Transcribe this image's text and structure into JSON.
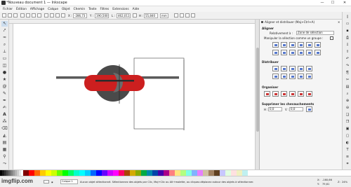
{
  "window": {
    "title": "*Nouveau document 1 — Inkscape",
    "min": "—",
    "max": "☐",
    "close": "✕"
  },
  "menu": [
    "Fichier",
    "Édition",
    "Affichage",
    "Calque",
    "Objet",
    "Chemin",
    "Texte",
    "Filtres",
    "Extensions",
    "Aide"
  ],
  "toolctrl": {
    "x_label": "X :",
    "x": "-286,73",
    "y_label": "Y :",
    "y": "190,500",
    "w_label": "L :",
    "w": "462,011",
    "h_label": "H :",
    "h": "55,840",
    "unit": "mm"
  },
  "panel": {
    "title": "Aligner et distribuer (Maj+Ctrl+A)",
    "align_header": "Aligner",
    "relative_label": "Relativement à :",
    "relative_value": "Zone de sélection",
    "treat_label": "Manipuler la sélection comme un groupe :",
    "distribute_header": "Distribuer",
    "arrange_header": "Organiser",
    "overlap_header": "Supprimer les chevauchements",
    "h_label": "H :",
    "h_value": "0,0",
    "v_label": "V :",
    "v_value": "0,0"
  },
  "status": {
    "layer": "Calque 1",
    "message": "Aucun objet sélectionné. Sélectionnez des objets par Clic, Maj+Clic ou Alt+molette, ou cliquez-déplacez autour des objets à sélectionner.",
    "x_label": "X:",
    "x": "-160,66",
    "y_label": "Y:",
    "y": "79,61",
    "z_label": "Z:",
    "zoom": "24%"
  },
  "colors": {
    "red": "#cc1f1f",
    "gray": "#4a4a4a",
    "dark": "#2b2b2b"
  },
  "watermark": "imgflip.com"
}
